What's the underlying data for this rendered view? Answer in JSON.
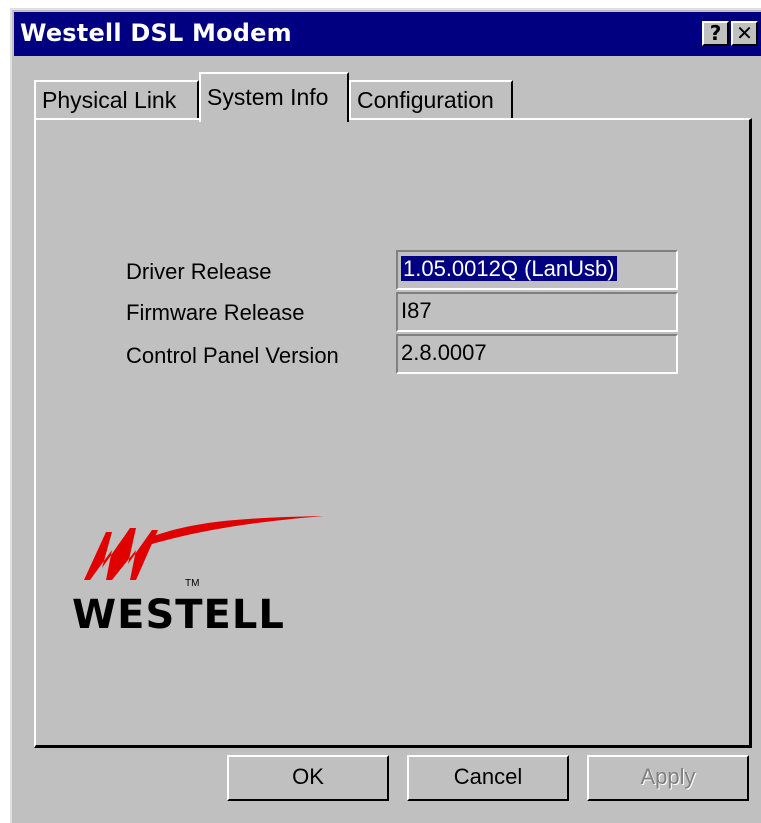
{
  "window": {
    "title": "Westell DSL Modem",
    "help_button": "?",
    "close_button": "✕"
  },
  "tabs": [
    {
      "label": "Physical Link"
    },
    {
      "label": "System Info",
      "active": true
    },
    {
      "label": "Configuration"
    }
  ],
  "system_info": {
    "driver_release": {
      "label": "Driver Release",
      "value": "1.05.0012Q (LanUsb)"
    },
    "firmware_release": {
      "label": "Firmware Release",
      "value": "I87"
    },
    "control_panel_version": {
      "label": "Control Panel Version",
      "value": "2.8.0007"
    }
  },
  "logo": {
    "text": "WESTELL",
    "tm": "TM",
    "accent_color": "#ff0000"
  },
  "buttons": {
    "ok": "OK",
    "cancel": "Cancel",
    "apply": "Apply"
  },
  "colors": {
    "titlebar": "#000080",
    "face": "#c0c0c0",
    "selection": "#000080"
  }
}
